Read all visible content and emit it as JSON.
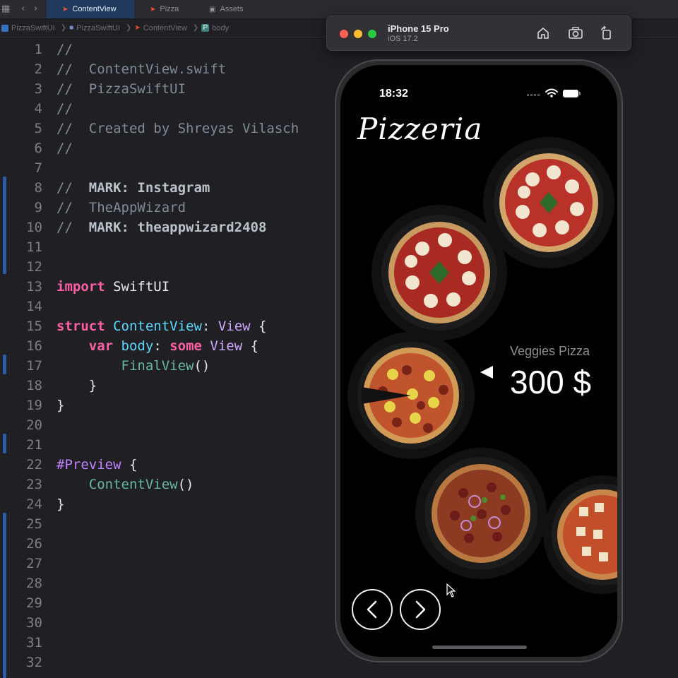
{
  "tabs": [
    {
      "label": "ContentView",
      "active": true,
      "icon": "swift-icon"
    },
    {
      "label": "Pizza",
      "active": false,
      "icon": "swift-icon"
    },
    {
      "label": "Assets",
      "active": false,
      "icon": "assets-icon"
    }
  ],
  "breadcrumb": [
    "PizzaSwiftUI",
    "PizzaSwiftUI",
    "ContentView",
    "body"
  ],
  "code_lines": [
    {
      "n": "1",
      "parts": [
        [
          "c-com",
          "//"
        ]
      ]
    },
    {
      "n": "2",
      "parts": [
        [
          "c-com",
          "//  ContentView.swift"
        ]
      ]
    },
    {
      "n": "3",
      "parts": [
        [
          "c-com",
          "//  PizzaSwiftUI"
        ]
      ]
    },
    {
      "n": "4",
      "parts": [
        [
          "c-com",
          "//"
        ]
      ]
    },
    {
      "n": "5",
      "parts": [
        [
          "c-com",
          "//  Created by Shreyas Vilasch"
        ]
      ]
    },
    {
      "n": "6",
      "parts": [
        [
          "c-com",
          "//"
        ]
      ]
    },
    {
      "n": "7",
      "parts": []
    },
    {
      "n": "8",
      "parts": [
        [
          "c-com",
          "//  "
        ],
        [
          "c-mark",
          "MARK: Instagram"
        ]
      ]
    },
    {
      "n": "9",
      "parts": [
        [
          "c-com",
          "//  TheAppWizard"
        ]
      ]
    },
    {
      "n": "10",
      "parts": [
        [
          "c-com",
          "//  "
        ],
        [
          "c-mark",
          "MARK: theappwizard2408"
        ]
      ]
    },
    {
      "n": "11",
      "parts": []
    },
    {
      "n": "12",
      "parts": []
    },
    {
      "n": "13",
      "parts": [
        [
          "c-kw",
          "import"
        ],
        [
          "c-plain",
          " SwiftUI"
        ]
      ]
    },
    {
      "n": "14",
      "parts": []
    },
    {
      "n": "15",
      "parts": [
        [
          "c-kw",
          "struct"
        ],
        [
          "c-plain",
          " "
        ],
        [
          "c-type",
          "ContentView"
        ],
        [
          "c-plain",
          ": "
        ],
        [
          "c-sys",
          "View"
        ],
        [
          "c-plain",
          " {"
        ]
      ]
    },
    {
      "n": "16",
      "parts": [
        [
          "c-plain",
          "    "
        ],
        [
          "c-kw",
          "var"
        ],
        [
          "c-plain",
          " "
        ],
        [
          "c-type",
          "body"
        ],
        [
          "c-plain",
          ": "
        ],
        [
          "c-kw",
          "some"
        ],
        [
          "c-plain",
          " "
        ],
        [
          "c-sys",
          "View"
        ],
        [
          "c-plain",
          " {"
        ]
      ]
    },
    {
      "n": "17",
      "parts": [
        [
          "c-plain",
          "        "
        ],
        [
          "c-call",
          "FinalView"
        ],
        [
          "c-plain",
          "()"
        ]
      ]
    },
    {
      "n": "18",
      "parts": [
        [
          "c-plain",
          "    }"
        ]
      ]
    },
    {
      "n": "19",
      "parts": [
        [
          "c-plain",
          "}"
        ]
      ]
    },
    {
      "n": "20",
      "parts": []
    },
    {
      "n": "21",
      "parts": []
    },
    {
      "n": "22",
      "parts": [
        [
          "c-macro",
          "#Preview"
        ],
        [
          "c-plain",
          " {"
        ]
      ]
    },
    {
      "n": "23",
      "parts": [
        [
          "c-plain",
          "    "
        ],
        [
          "c-call",
          "ContentView"
        ],
        [
          "c-plain",
          "()"
        ]
      ]
    },
    {
      "n": "24",
      "parts": [
        [
          "c-plain",
          "}"
        ]
      ]
    },
    {
      "n": "25",
      "parts": []
    },
    {
      "n": "26",
      "parts": []
    },
    {
      "n": "27",
      "parts": []
    },
    {
      "n": "28",
      "parts": []
    },
    {
      "n": "29",
      "parts": []
    },
    {
      "n": "30",
      "parts": []
    },
    {
      "n": "31",
      "parts": []
    },
    {
      "n": "32",
      "parts": []
    }
  ],
  "simulator": {
    "device": "iPhone 15 Pro",
    "os": "iOS 17.2",
    "buttons": [
      "home-icon",
      "screenshot-icon",
      "rotate-icon"
    ]
  },
  "app": {
    "status_time": "18:32",
    "title": "Pizzeria",
    "selected_name": "Veggies Pizza",
    "selected_price": "300 $",
    "prev_icon": "chevron-left-icon",
    "next_icon": "chevron-right-icon"
  },
  "colors": {
    "editor_bg": "#1f1f24",
    "active_tab": "#1f3a5c",
    "keyword": "#fc5fa3",
    "type": "#5dd8ff",
    "comment": "#7f8c98"
  }
}
